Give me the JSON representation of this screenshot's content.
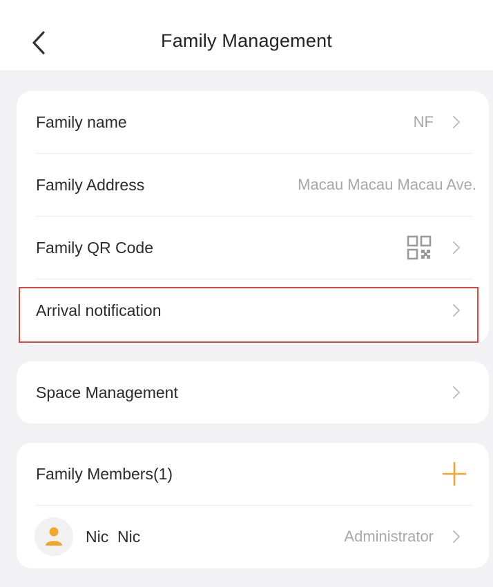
{
  "header": {
    "title": "Family Management",
    "back_icon": "chevron-left-icon"
  },
  "family_info": {
    "name_label": "Family name",
    "name_value": "NF",
    "address_label": "Family Address",
    "address_value": "Macau Macau Macau Ave.",
    "qr_label": "Family QR Code",
    "qr_icon": "qr-code-icon",
    "arrival_label": "Arrival notification"
  },
  "space": {
    "label": "Space Management"
  },
  "members": {
    "header_label": "Family Members(1)",
    "add_icon": "plus-icon",
    "list": [
      {
        "name": "Nic  Nic",
        "role": "Administrator",
        "avatar_icon": "user-avatar-icon"
      }
    ]
  },
  "colors": {
    "accent": "#f3a52a",
    "highlight_border": "#e0453a",
    "background": "#f2f2f4"
  }
}
